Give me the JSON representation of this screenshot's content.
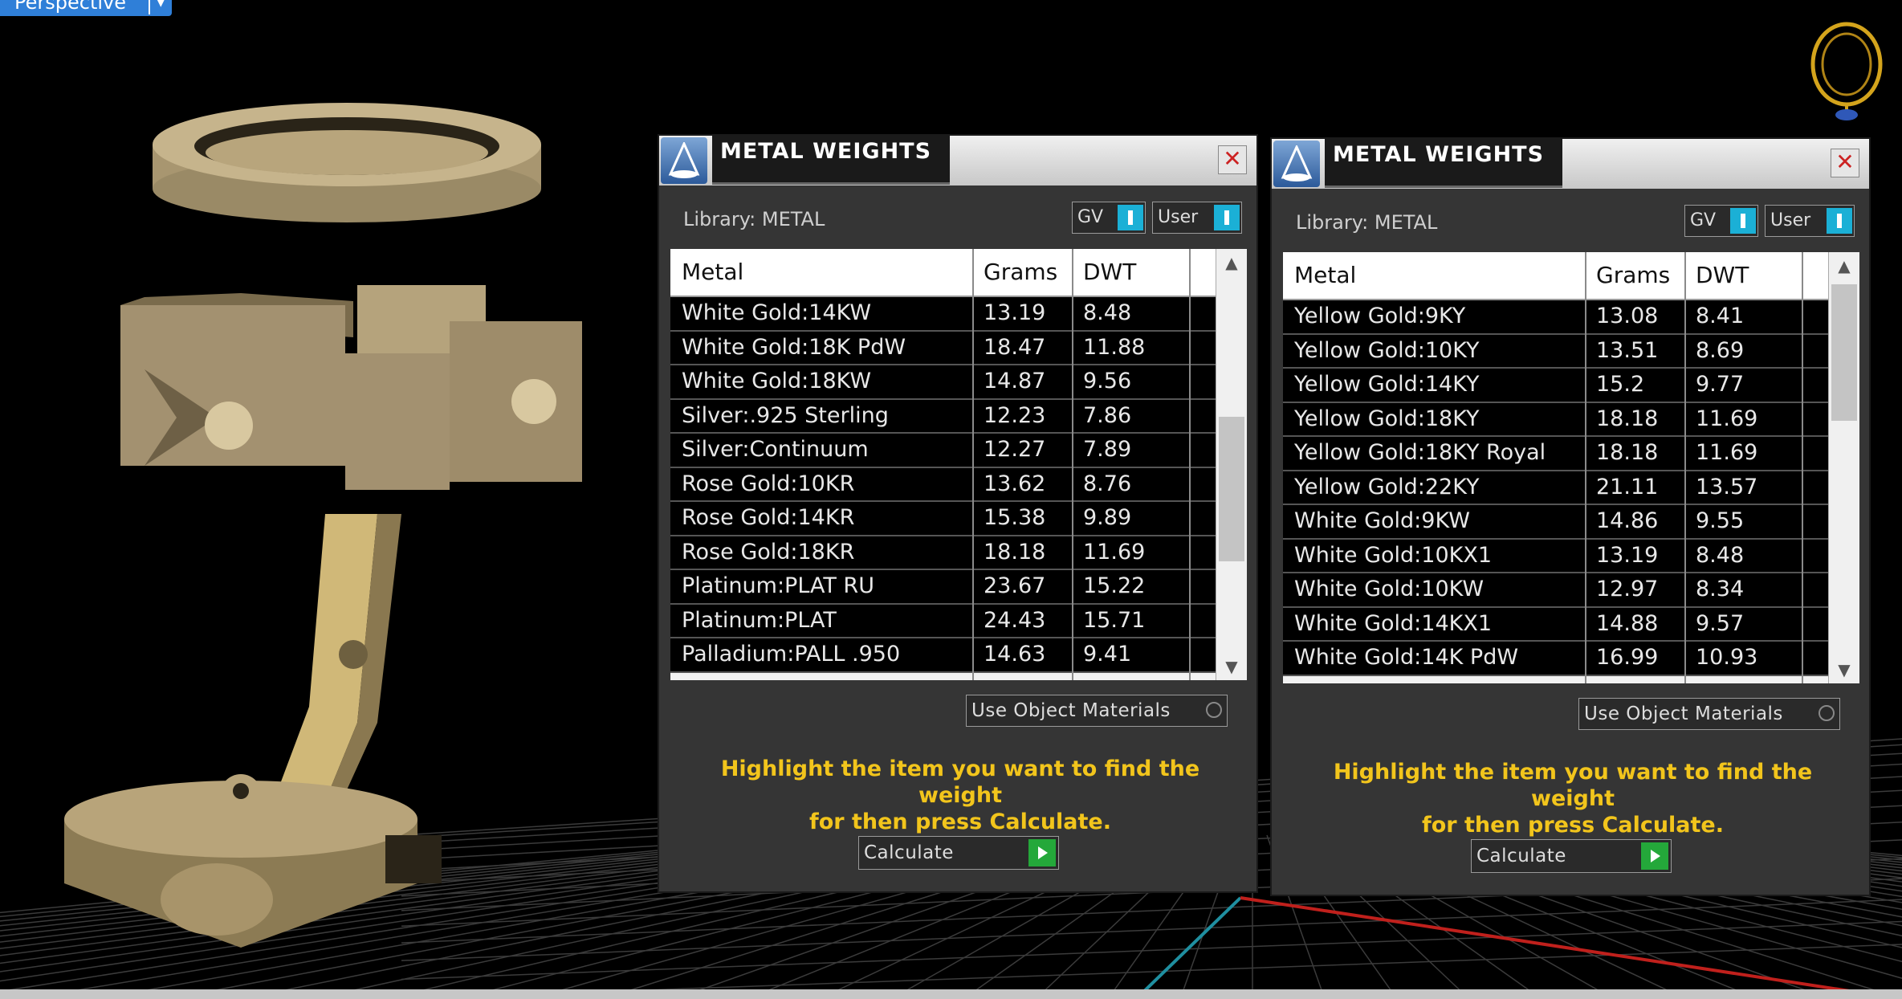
{
  "viewport": {
    "label": "Perspective",
    "menu_icon": "chevron-down-icon"
  },
  "panels": [
    {
      "title": "METAL WEIGHTS",
      "close_icon": "close-icon",
      "library": "Library: METAL",
      "toggle_gv": "GV",
      "toggle_user": "User",
      "columns": [
        "Metal",
        "Grams",
        "DWT"
      ],
      "rows": [
        [
          "White Gold:14KW",
          "13.19",
          "8.48"
        ],
        [
          "White Gold:18K PdW",
          "18.47",
          "11.88"
        ],
        [
          "White Gold:18KW",
          "14.87",
          "9.56"
        ],
        [
          "Silver:.925 Sterling",
          "12.23",
          "7.86"
        ],
        [
          "Silver:Continuum",
          "12.27",
          "7.89"
        ],
        [
          "Rose Gold:10KR",
          "13.62",
          "8.76"
        ],
        [
          "Rose Gold:14KR",
          "15.38",
          "9.89"
        ],
        [
          "Rose Gold:18KR",
          "18.18",
          "11.69"
        ],
        [
          "Platinum:PLAT RU",
          "23.67",
          "15.22"
        ],
        [
          "Platinum:PLAT",
          "24.43",
          "15.71"
        ],
        [
          "Palladium:PALL .950",
          "14.63",
          "9.41"
        ]
      ],
      "use_object_materials": "Use Object Materials",
      "hint_line1": "Highlight the item you want to find the weight",
      "hint_line2": "for then press Calculate.",
      "calculate": "Calculate"
    },
    {
      "title": "METAL WEIGHTS",
      "close_icon": "close-icon",
      "library": "Library: METAL",
      "toggle_gv": "GV",
      "toggle_user": "User",
      "columns": [
        "Metal",
        "Grams",
        "DWT"
      ],
      "rows": [
        [
          "Yellow Gold:9KY",
          "13.08",
          "8.41"
        ],
        [
          "Yellow Gold:10KY",
          "13.51",
          "8.69"
        ],
        [
          "Yellow Gold:14KY",
          "15.2",
          "9.77"
        ],
        [
          "Yellow Gold:18KY",
          "18.18",
          "11.69"
        ],
        [
          "Yellow Gold:18KY Royal",
          "18.18",
          "11.69"
        ],
        [
          "Yellow Gold:22KY",
          "21.11",
          "13.57"
        ],
        [
          "White Gold:9KW",
          "14.86",
          "9.55"
        ],
        [
          "White Gold:10KX1",
          "13.19",
          "8.48"
        ],
        [
          "White Gold:10KW",
          "12.97",
          "8.34"
        ],
        [
          "White Gold:14KX1",
          "14.88",
          "9.57"
        ],
        [
          "White Gold:14K PdW",
          "16.99",
          "10.93"
        ]
      ],
      "use_object_materials": "Use Object Materials",
      "hint_line1": "Highlight the item you want to find the weight",
      "hint_line2": "for then press Calculate.",
      "calculate": "Calculate"
    }
  ],
  "colors": {
    "hint": "#f2c51c",
    "toggle_on": "#1bb0d6",
    "calculate_go": "#24a83a",
    "panel_bg": "#353535",
    "viewport_bg": "#000000",
    "metal_model": "#b09a6e"
  }
}
